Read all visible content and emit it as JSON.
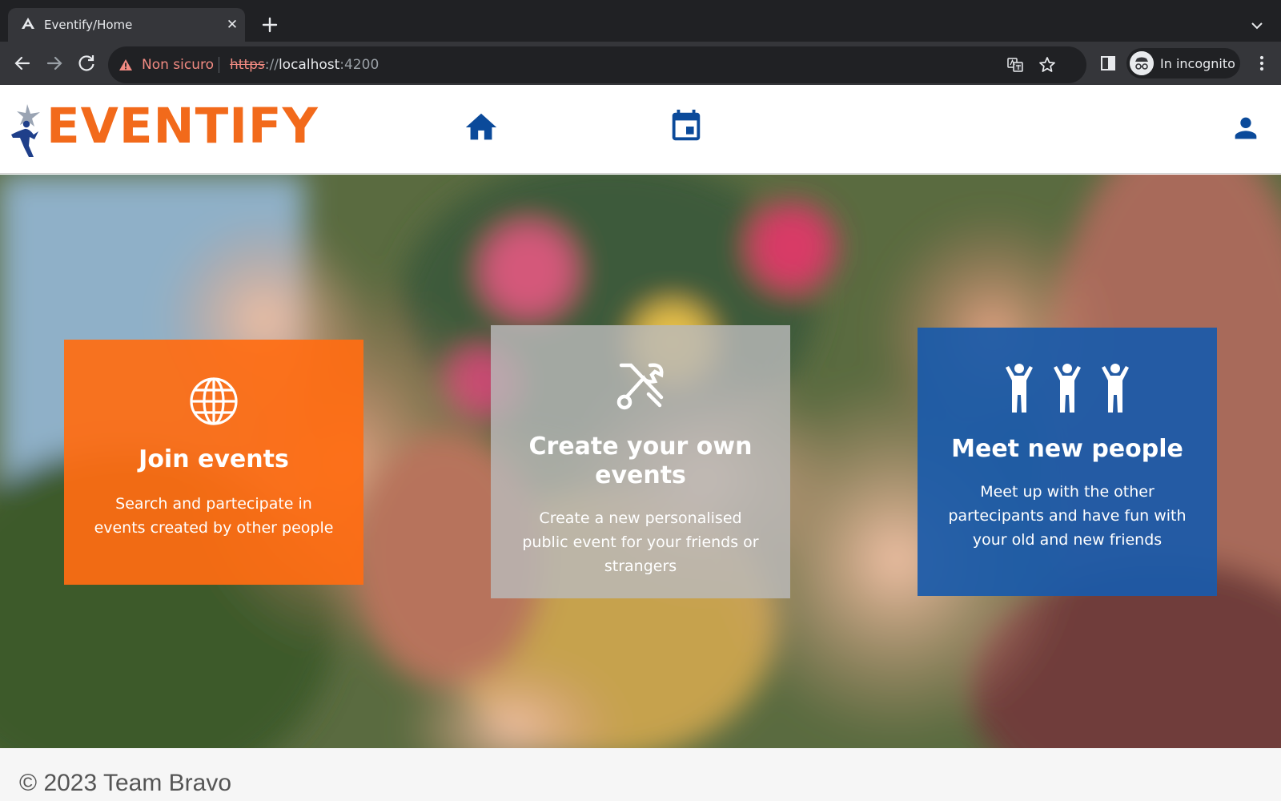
{
  "browser": {
    "tab": {
      "title": "Eventify/Home",
      "favicon": "angular-logo-icon",
      "close": "✕"
    },
    "address_bar": {
      "security_label": "Non sicuro",
      "url_scheme": "https",
      "url_separator": "://",
      "url_host": "localhost",
      "url_port": ":4200"
    },
    "incognito_label": "In incognito",
    "icons": [
      "back-icon",
      "forward-icon",
      "reload-icon",
      "warning-icon",
      "translate-icon",
      "star-icon",
      "side-panel-icon",
      "incognito-icon",
      "more-menu-icon",
      "new-tab-icon",
      "tab-list-icon"
    ]
  },
  "header": {
    "logo_text": "EVENTIFY",
    "nav": [
      {
        "name": "home",
        "icon": "home-icon"
      },
      {
        "name": "calendar",
        "icon": "calendar-icon"
      }
    ],
    "profile_icon": "person-icon"
  },
  "hero": {
    "cards": [
      {
        "title": "Join events",
        "description": "Search and partecipate in events created by other people",
        "icon": "globe-icon",
        "color": "#ff6d12"
      },
      {
        "title": "Create your own events",
        "description": "Create a new personalised public event for your friends or strangers",
        "icon": "tools-icon",
        "color": "#b9b9b9"
      },
      {
        "title": "Meet new people",
        "description": "Meet up with the other partecipants and have fun with your old and new friends",
        "icon": "people-icon",
        "color": "#1a5aaa"
      }
    ]
  },
  "footer": {
    "text": "© 2023 Team Bravo"
  },
  "colors": {
    "brand_orange": "#f26a1b",
    "brand_blue": "#0b4a9a",
    "chrome_dark": "#202124",
    "chrome_mid": "#35363a"
  }
}
